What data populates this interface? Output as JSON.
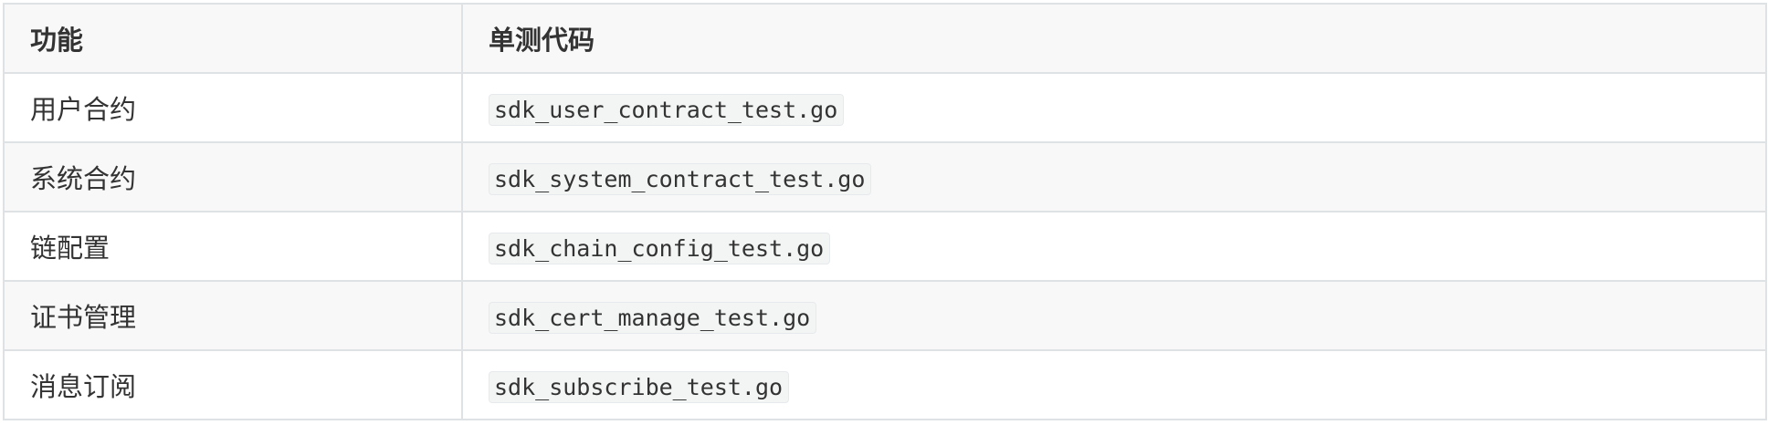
{
  "table": {
    "headers": [
      "功能",
      "单测代码"
    ],
    "rows": [
      {
        "feature": "用户合约",
        "code": "sdk_user_contract_test.go"
      },
      {
        "feature": "系统合约",
        "code": "sdk_system_contract_test.go"
      },
      {
        "feature": "链配置",
        "code": "sdk_chain_config_test.go"
      },
      {
        "feature": "证书管理",
        "code": "sdk_cert_manage_test.go"
      },
      {
        "feature": "消息订阅",
        "code": "sdk_subscribe_test.go"
      }
    ]
  }
}
